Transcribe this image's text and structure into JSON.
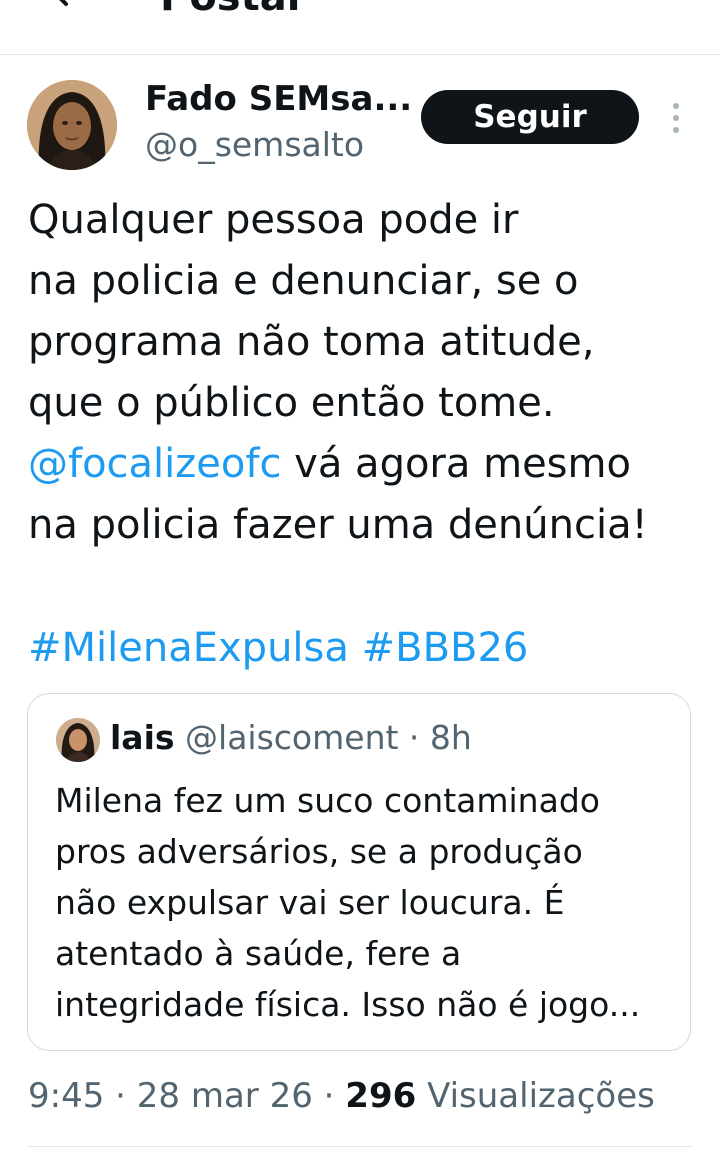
{
  "header": {
    "title": "Postar"
  },
  "author": {
    "name": "Fado SEMsa...",
    "handle": "@o_semsalto"
  },
  "follow_button": {
    "label": "Seguir"
  },
  "tweet": {
    "lines": [
      "Qualquer pessoa pode ir",
      "na policia e denunciar, se o",
      "programa não toma atitude,",
      "que o público então tome."
    ],
    "mention": "@focalizeofc",
    "mention_suffix": " vá agora mesmo",
    "last_line": "na policia fazer uma denúncia!",
    "hashtags": [
      "#MilenaExpulsa",
      "#BBB26"
    ]
  },
  "quote": {
    "name": "lais",
    "meta": " @laiscoment · 8h",
    "lines": [
      "Milena fez um suco contaminado",
      "pros adversários, se a produção",
      "não expulsar vai ser loucura. É",
      "atentado à saúde, fere a",
      "integridade física. Isso não é jogo..."
    ]
  },
  "meta_row": {
    "time_date": "9:45 · 28 mar 26 · ",
    "views_count": "296",
    "views_label": " Visualizações"
  },
  "icons": {
    "back": "arrow-left-icon",
    "more": "more-vertical-icon"
  },
  "colors": {
    "link": "#1d9bf0",
    "text": "#0f1419",
    "secondary": "#536471",
    "button_bg": "#0f1419"
  }
}
